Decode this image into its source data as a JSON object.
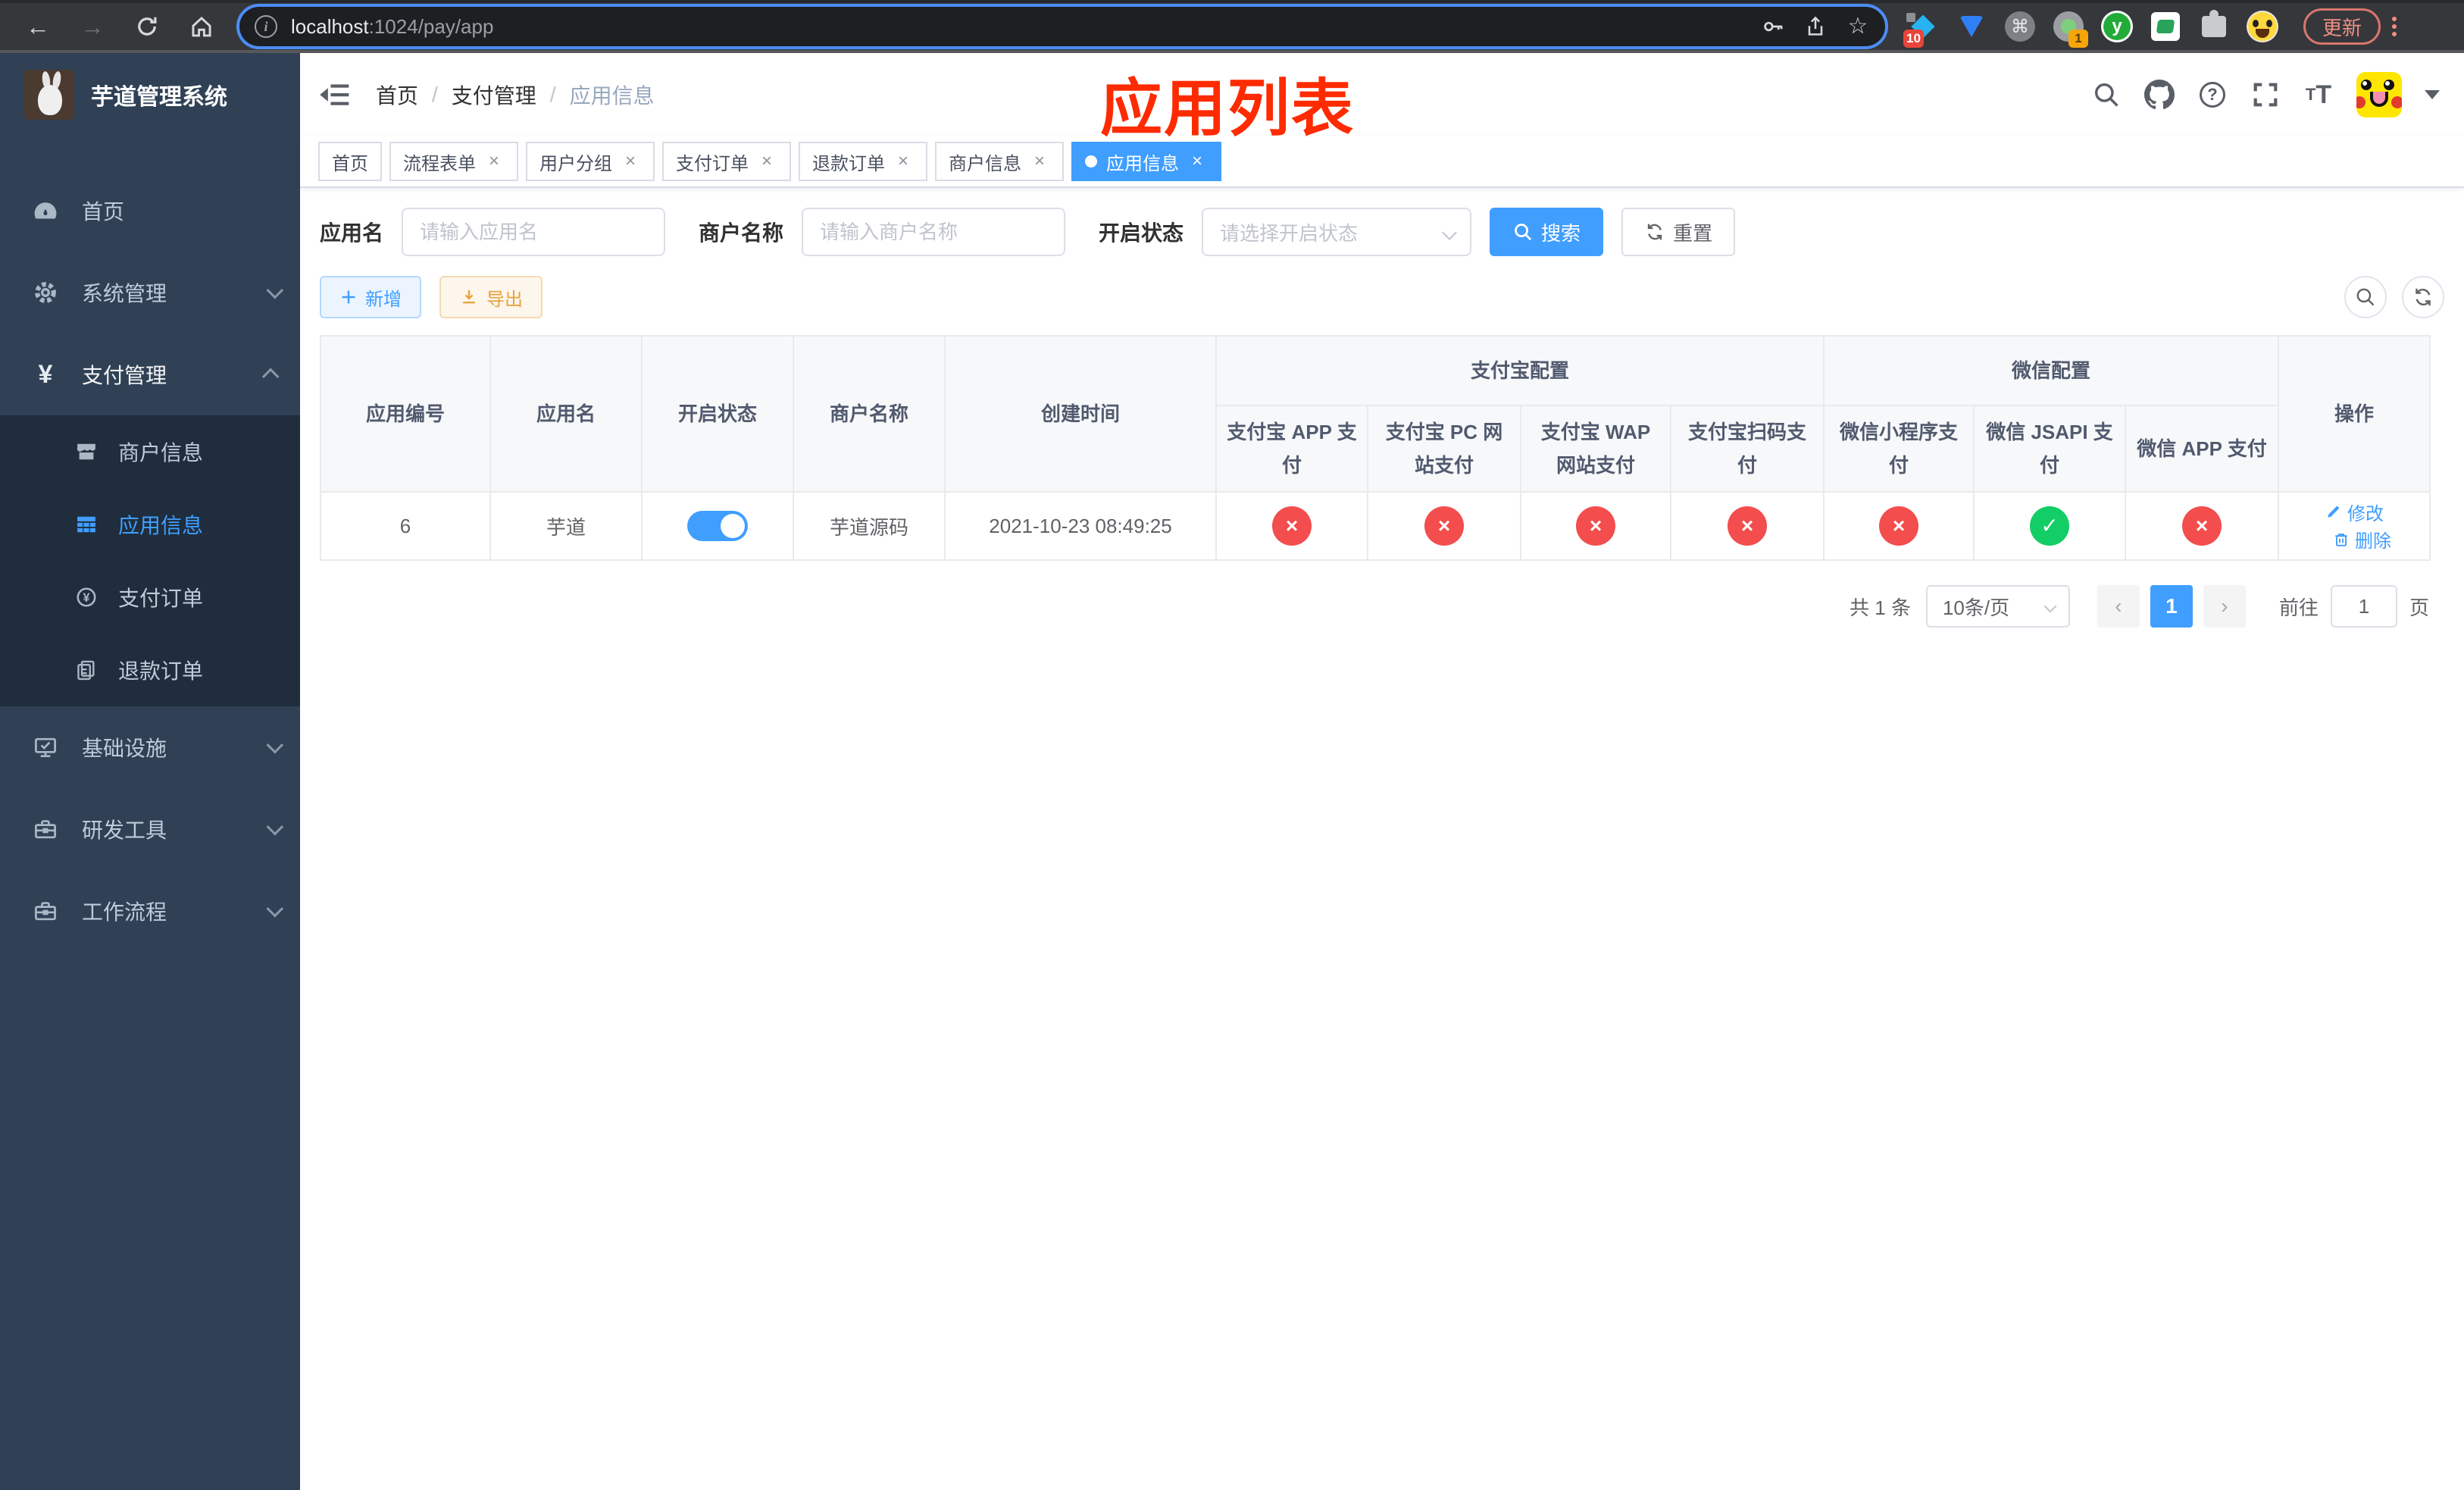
{
  "browser": {
    "url": {
      "host": "localhost",
      "path": ":1024/pay/app"
    },
    "extension_badge_blue_diamond": "10",
    "extension_badge_green_dot": "1",
    "update_button": "更新"
  },
  "sidebar": {
    "title": "芋道管理系统",
    "menu": [
      {
        "label": "首页"
      },
      {
        "label": "系统管理"
      },
      {
        "label": "支付管理"
      },
      {
        "label": "基础设施"
      },
      {
        "label": "研发工具"
      },
      {
        "label": "工作流程"
      }
    ],
    "submenu": [
      {
        "label": "商户信息"
      },
      {
        "label": "应用信息"
      },
      {
        "label": "支付订单"
      },
      {
        "label": "退款订单"
      }
    ]
  },
  "navbar": {
    "breadcrumb": [
      "首页",
      "支付管理",
      "应用信息"
    ],
    "separator": "/",
    "annotation": "应用列表"
  },
  "tabs": [
    {
      "label": "首页"
    },
    {
      "label": "流程表单"
    },
    {
      "label": "用户分组"
    },
    {
      "label": "支付订单"
    },
    {
      "label": "退款订单"
    },
    {
      "label": "商户信息"
    },
    {
      "label": "应用信息"
    }
  ],
  "search": {
    "app_name_label": "应用名",
    "app_name_placeholder": "请输入应用名",
    "merchant_label": "商户名称",
    "merchant_placeholder": "请输入商户名称",
    "status_label": "开启状态",
    "status_placeholder": "请选择开启状态",
    "search_button": "搜索",
    "reset_button": "重置"
  },
  "toolbar": {
    "add_button": "新增",
    "export_button": "导出"
  },
  "table": {
    "col_app_id": "应用编号",
    "col_app_name": "应用名",
    "col_status": "开启状态",
    "col_merchant": "商户名称",
    "col_created": "创建时间",
    "group_alipay": "支付宝配置",
    "group_wechat": "微信配置",
    "col_alipay_app": "支付宝 APP 支付",
    "col_alipay_pc": "支付宝 PC 网站支付",
    "col_alipay_wap": "支付宝 WAP 网站支付",
    "col_alipay_qr": "支付宝扫码支付",
    "col_wx_mini": "微信小程序支付",
    "col_wx_jsapi": "微信 JSAPI 支付",
    "col_wx_app": "微信 APP 支付",
    "col_action": "操作",
    "row": {
      "id": "6",
      "app_name": "芋道",
      "enabled": true,
      "merchant_name": "芋道源码",
      "create_time": "2021-10-23 08:49:25",
      "pay_channels": [
        {
          "name": "alipay-app",
          "enabled": false
        },
        {
          "name": "alipay-pc",
          "enabled": false
        },
        {
          "name": "alipay-wap",
          "enabled": false
        },
        {
          "name": "alipay-qr",
          "enabled": false
        },
        {
          "name": "wx-mini",
          "enabled": false
        },
        {
          "name": "wx-jsapi",
          "enabled": true
        },
        {
          "name": "wx-app",
          "enabled": false
        }
      ],
      "edit_label": "修改",
      "delete_label": "删除"
    }
  },
  "pagination": {
    "total": "共 1 条",
    "page_size": "10条/页",
    "current_page": "1",
    "goto_label": "前往",
    "goto_value": "1",
    "unit_label": "页"
  },
  "colors": {
    "primary": "#409eff",
    "success": "#13ce66",
    "danger": "#f34d4d",
    "sidebar_bg": "#304156",
    "submenu_bg": "#1f2d3d",
    "annotation": "#fe2b00"
  }
}
